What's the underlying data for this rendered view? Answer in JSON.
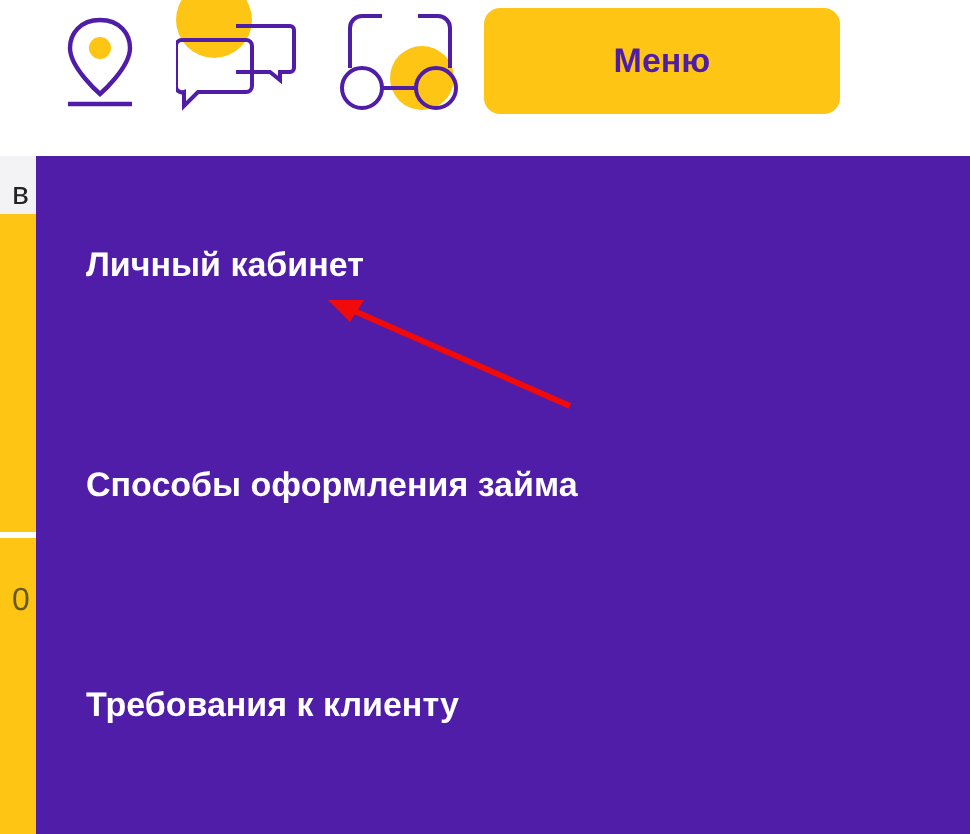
{
  "header": {
    "menu_button": "Меню"
  },
  "side_strip": {
    "texts": [
      "в",
      "0"
    ]
  },
  "menu": {
    "items": [
      {
        "label": "Личный кабинет"
      },
      {
        "label": "Способы оформления займа"
      },
      {
        "label": "Требования к клиенту"
      }
    ]
  }
}
